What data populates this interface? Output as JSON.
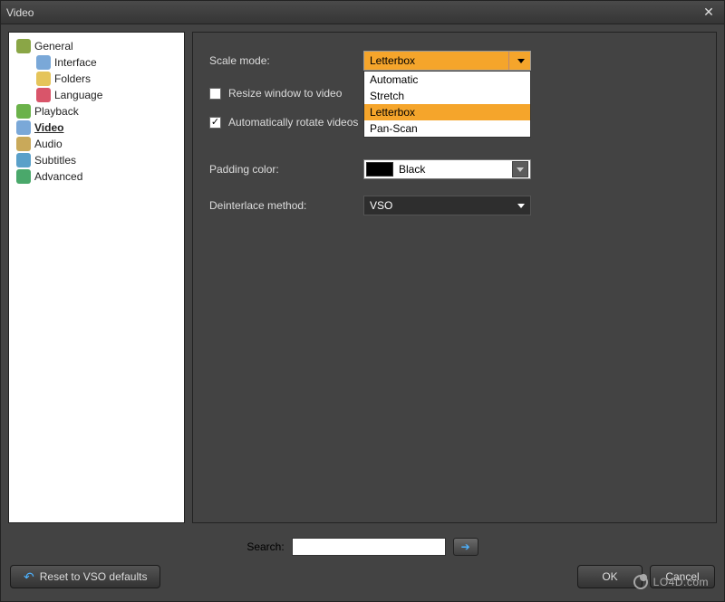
{
  "titlebar": {
    "title": "Video"
  },
  "sidebar": {
    "items": [
      {
        "label": "General",
        "level": 1,
        "icon": "gear-icon",
        "iconColor": "#8aa646"
      },
      {
        "label": "Interface",
        "level": 2,
        "icon": "window-icon",
        "iconColor": "#7aa8d8"
      },
      {
        "label": "Folders",
        "level": 2,
        "icon": "folder-icon",
        "iconColor": "#e5c45a"
      },
      {
        "label": "Language",
        "level": 2,
        "icon": "flag-icon",
        "iconColor": "#d9556a"
      },
      {
        "label": "Playback",
        "level": 1,
        "icon": "play-icon",
        "iconColor": "#6bb24a"
      },
      {
        "label": "Video",
        "level": 1,
        "icon": "film-icon",
        "iconColor": "#7aa8d8",
        "active": true
      },
      {
        "label": "Audio",
        "level": 1,
        "icon": "speaker-icon",
        "iconColor": "#c9a95a"
      },
      {
        "label": "Subtitles",
        "level": 1,
        "icon": "subtitle-icon",
        "iconColor": "#5aa0c9"
      },
      {
        "label": "Advanced",
        "level": 1,
        "icon": "advanced-icon",
        "iconColor": "#4aa86b"
      }
    ]
  },
  "content": {
    "scaleMode": {
      "label": "Scale mode:",
      "value": "Letterbox",
      "options": [
        "Automatic",
        "Stretch",
        "Letterbox",
        "Pan-Scan"
      ],
      "selectedIndex": 2
    },
    "resizeCheckbox": {
      "label": "Resize window to video",
      "checked": false
    },
    "rotateCheckbox": {
      "label": "Automatically rotate videos",
      "checked": true
    },
    "paddingColor": {
      "label": "Padding color:",
      "value": "Black",
      "swatch": "#000000"
    },
    "deinterlace": {
      "label": "Deinterlace method:",
      "value": "VSO"
    }
  },
  "footer": {
    "searchLabel": "Search:",
    "searchValue": "",
    "resetLabel": "Reset to VSO defaults",
    "okLabel": "OK",
    "cancelLabel": "Cancel"
  },
  "watermark": "LO4D.com"
}
